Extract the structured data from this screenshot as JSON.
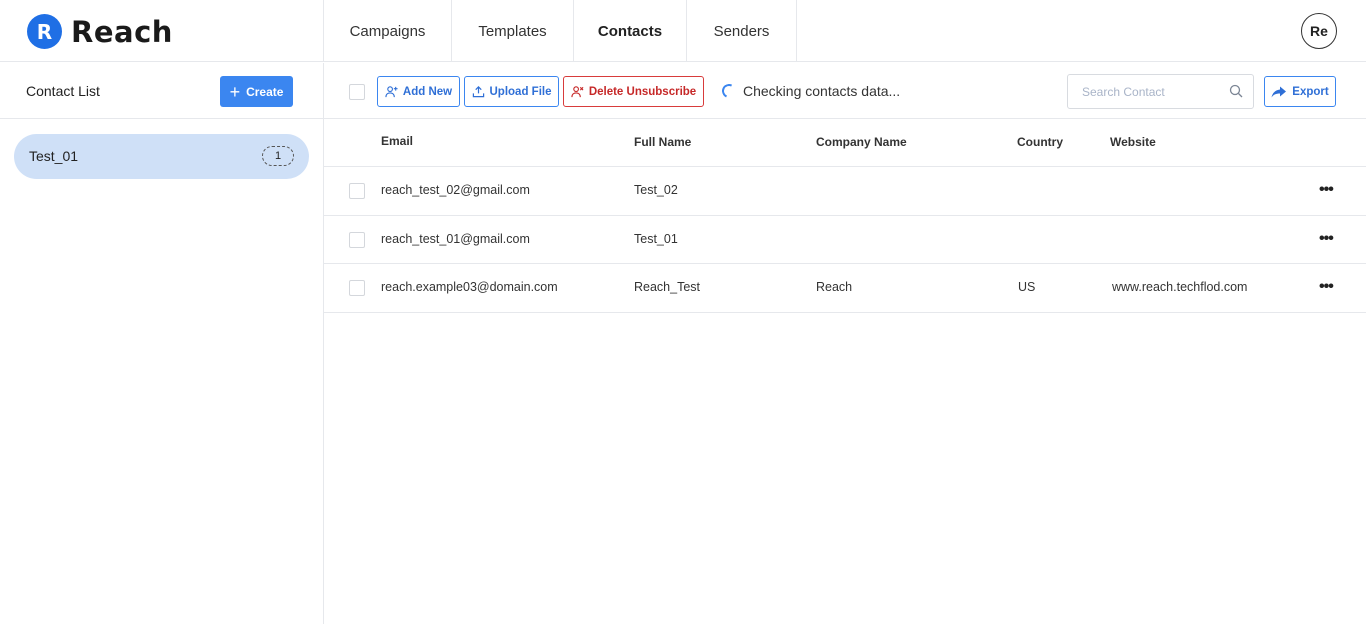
{
  "brand": {
    "mark": "R",
    "name": "Reach"
  },
  "nav": {
    "tabs": [
      {
        "label": "Campaigns"
      },
      {
        "label": "Templates"
      },
      {
        "label": "Contacts"
      },
      {
        "label": "Senders"
      }
    ],
    "active": "Contacts"
  },
  "user": {
    "initials": "Re"
  },
  "sidebar": {
    "title": "Contact List",
    "create_label": "Create",
    "lists": [
      {
        "name": "Test_01",
        "count": "1"
      }
    ]
  },
  "toolbar": {
    "add_label": "Add New",
    "upload_label": "Upload File",
    "delete_label": "Delete Unsubscribe",
    "status_text": "Checking contacts data...",
    "search_placeholder": "Search Contact",
    "export_label": "Export"
  },
  "table": {
    "headers": {
      "email": "Email",
      "full_name": "Full Name",
      "company": "Company Name",
      "country": "Country",
      "website": "Website"
    },
    "rows": [
      {
        "email": "reach_test_02@gmail.com",
        "full_name": "Test_02",
        "company": "",
        "country": "",
        "website": ""
      },
      {
        "email": "reach_test_01@gmail.com",
        "full_name": "Test_01",
        "company": "",
        "country": "",
        "website": ""
      },
      {
        "email": "reach.example03@domain.com",
        "full_name": "Reach_Test",
        "company": "Reach",
        "country": "US",
        "website": "www.reach.techflod.com"
      }
    ],
    "row_menu_glyph": "•••"
  },
  "colors": {
    "accent": "#3b86f0",
    "danger": "#d83b3b",
    "selected_list_bg": "#cfe0f7"
  }
}
